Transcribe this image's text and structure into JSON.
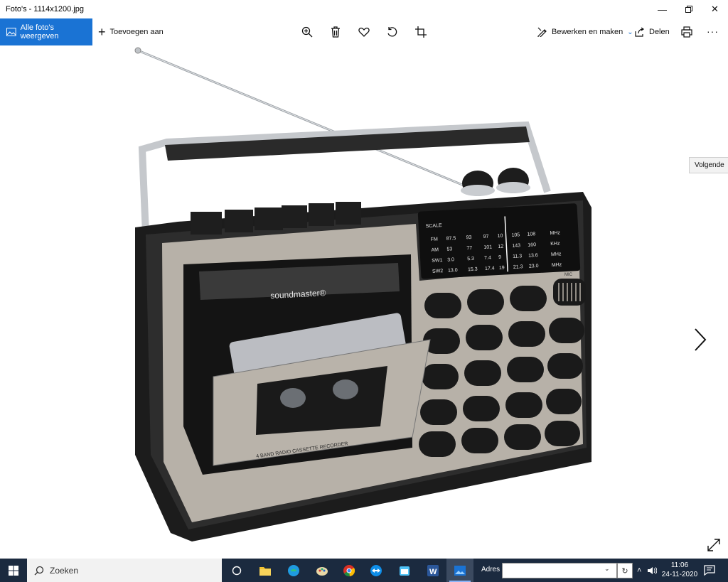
{
  "window": {
    "title": "Foto's - 1114x1200.jpg"
  },
  "toolbar": {
    "all_photos_label": "Alle foto's weergeven",
    "add_label": "Toevoegen aan",
    "edit_label": "Bewerken en maken",
    "share_label": "Delen",
    "more_label": "···"
  },
  "viewer": {
    "tooltip": "Volgende",
    "image": {
      "brand": "soundmaster®",
      "cassette_label": "4 BAND RADIO CASSETTE RECORDER",
      "mic_label": "MIC",
      "dial": {
        "scale_label": "SCALE",
        "bands": [
          {
            "name": "FM",
            "values": [
              "87.5",
              "93",
              "97",
              "10",
              "105",
              "108"
            ],
            "unit": "MHz"
          },
          {
            "name": "AM",
            "values": [
              "53",
              "77",
              "101",
              "12",
              "143",
              "160"
            ],
            "unit": "KHz"
          },
          {
            "name": "SW1",
            "values": [
              "3.0",
              "5.3",
              "7.4",
              "9",
              "11.3",
              "13.6"
            ],
            "unit": "MHz"
          },
          {
            "name": "SW2",
            "values": [
              "13.0",
              "15.3",
              "17.4",
              "19",
              "21.3",
              "23.0"
            ],
            "unit": "MHz"
          }
        ]
      }
    }
  },
  "taskbar": {
    "search_placeholder": "Zoeken",
    "address_label": "Adres",
    "time": "11:06",
    "date": "24-11-2020"
  },
  "icons": [
    "photo-icon",
    "plus-icon",
    "zoom-in-icon",
    "delete-icon",
    "heart-icon",
    "rotate-icon",
    "crop-icon",
    "edit-icon",
    "share-icon",
    "print-icon",
    "next-arrow-icon",
    "expand-icon",
    "windows-icon",
    "search-icon",
    "task-view-icon",
    "file-explorer-icon",
    "edge-icon",
    "paint-icon",
    "chrome-icon",
    "teamviewer-icon",
    "calendar-icon",
    "word-icon",
    "photos-icon"
  ]
}
